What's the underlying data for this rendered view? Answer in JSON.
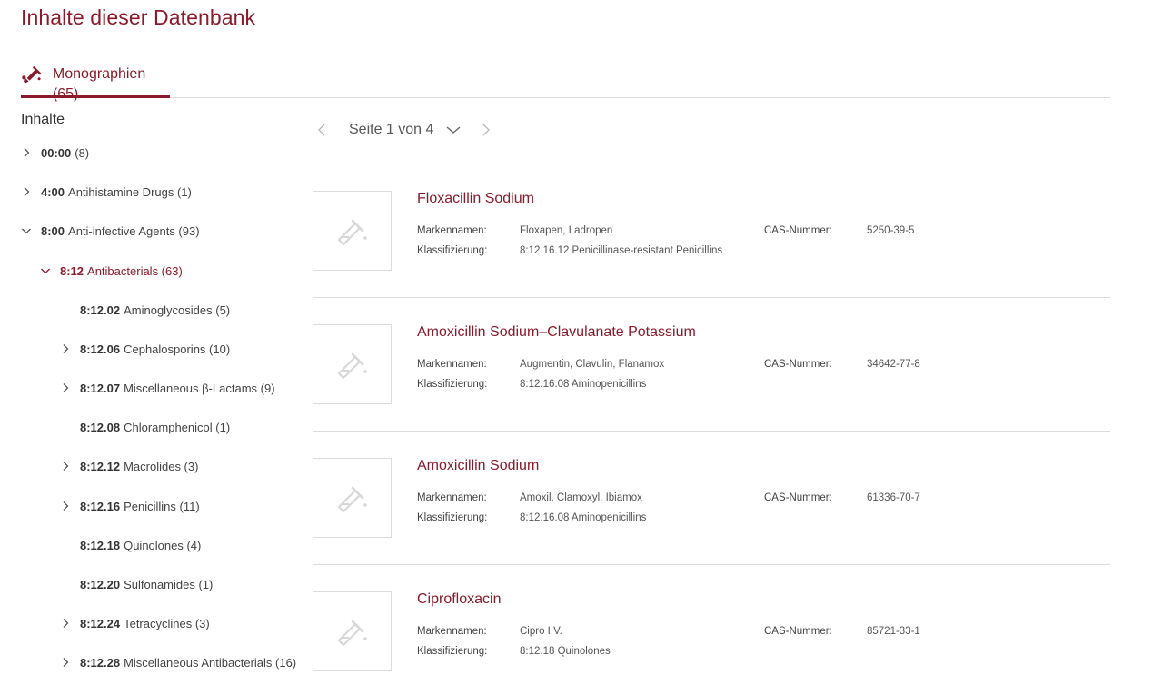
{
  "page": {
    "title": "Inhalte dieser Datenbank"
  },
  "tabs": [
    {
      "label": "Monographien (65)",
      "icon": "test-tube-icon",
      "active": true
    }
  ],
  "sidebar": {
    "title": "Inhalte",
    "items": [
      {
        "code": "00:00",
        "label": "(8)",
        "chevron": "right",
        "level": 0
      },
      {
        "code": "4:00",
        "label": "Antihistamine Drugs (1)",
        "chevron": "right",
        "level": 0
      },
      {
        "code": "8:00",
        "label": "Anti-infective Agents (93)",
        "chevron": "down",
        "level": 0
      },
      {
        "code": "8:12",
        "label": "Antibacterials (63)",
        "chevron": "down",
        "level": 1,
        "active": true
      },
      {
        "code": "8:12.02",
        "label": "Aminoglycosides (5)",
        "chevron": "none",
        "level": 2
      },
      {
        "code": "8:12.06",
        "label": "Cephalosporins (10)",
        "chevron": "right",
        "level": 2
      },
      {
        "code": "8:12.07",
        "label": "Miscellaneous β-Lactams (9)",
        "chevron": "right",
        "level": 2
      },
      {
        "code": "8:12.08",
        "label": "Chloramphenicol (1)",
        "chevron": "none",
        "level": 2
      },
      {
        "code": "8:12.12",
        "label": "Macrolides (3)",
        "chevron": "right",
        "level": 2
      },
      {
        "code": "8:12.16",
        "label": "Penicillins (11)",
        "chevron": "right",
        "level": 2
      },
      {
        "code": "8:12.18",
        "label": "Quinolones (4)",
        "chevron": "none",
        "level": 2
      },
      {
        "code": "8:12.20",
        "label": "Sulfonamides (1)",
        "chevron": "none",
        "level": 2
      },
      {
        "code": "8:12.24",
        "label": "Tetracyclines (3)",
        "chevron": "right",
        "level": 2
      },
      {
        "code": "8:12.28",
        "label": "Miscellaneous Antibacterials (16)",
        "chevron": "right",
        "level": 2
      }
    ]
  },
  "pager": {
    "label": "Seite 1 von 4"
  },
  "labels": {
    "brand": "Markennamen:",
    "class": "Klassifizierung:",
    "cas": "CAS-Nummer:"
  },
  "results": [
    {
      "title": "Floxacillin Sodium",
      "brands": "Floxapen, Ladropen",
      "classification": "8:12.16.12 Penicillinase-resistant Penicillins",
      "cas": "5250-39-5"
    },
    {
      "title": "Amoxicillin Sodium–Clavulanate Potassium",
      "brands": "Augmentin, Clavulin, Flanamox",
      "classification": "8:12.16.08 Aminopenicillins",
      "cas": "34642-77-8"
    },
    {
      "title": "Amoxicillin Sodium",
      "brands": "Amoxil, Clamoxyl, Ibiamox",
      "classification": "8:12.16.08 Aminopenicillins",
      "cas": "61336-70-7"
    },
    {
      "title": "Ciprofloxacin",
      "brands": "Cipro I.V.",
      "classification": "8:12.18 Quinolones",
      "cas": "85721-33-1"
    }
  ],
  "colors": {
    "accent": "#8b1a2b",
    "divider": "#dcdcdc"
  }
}
